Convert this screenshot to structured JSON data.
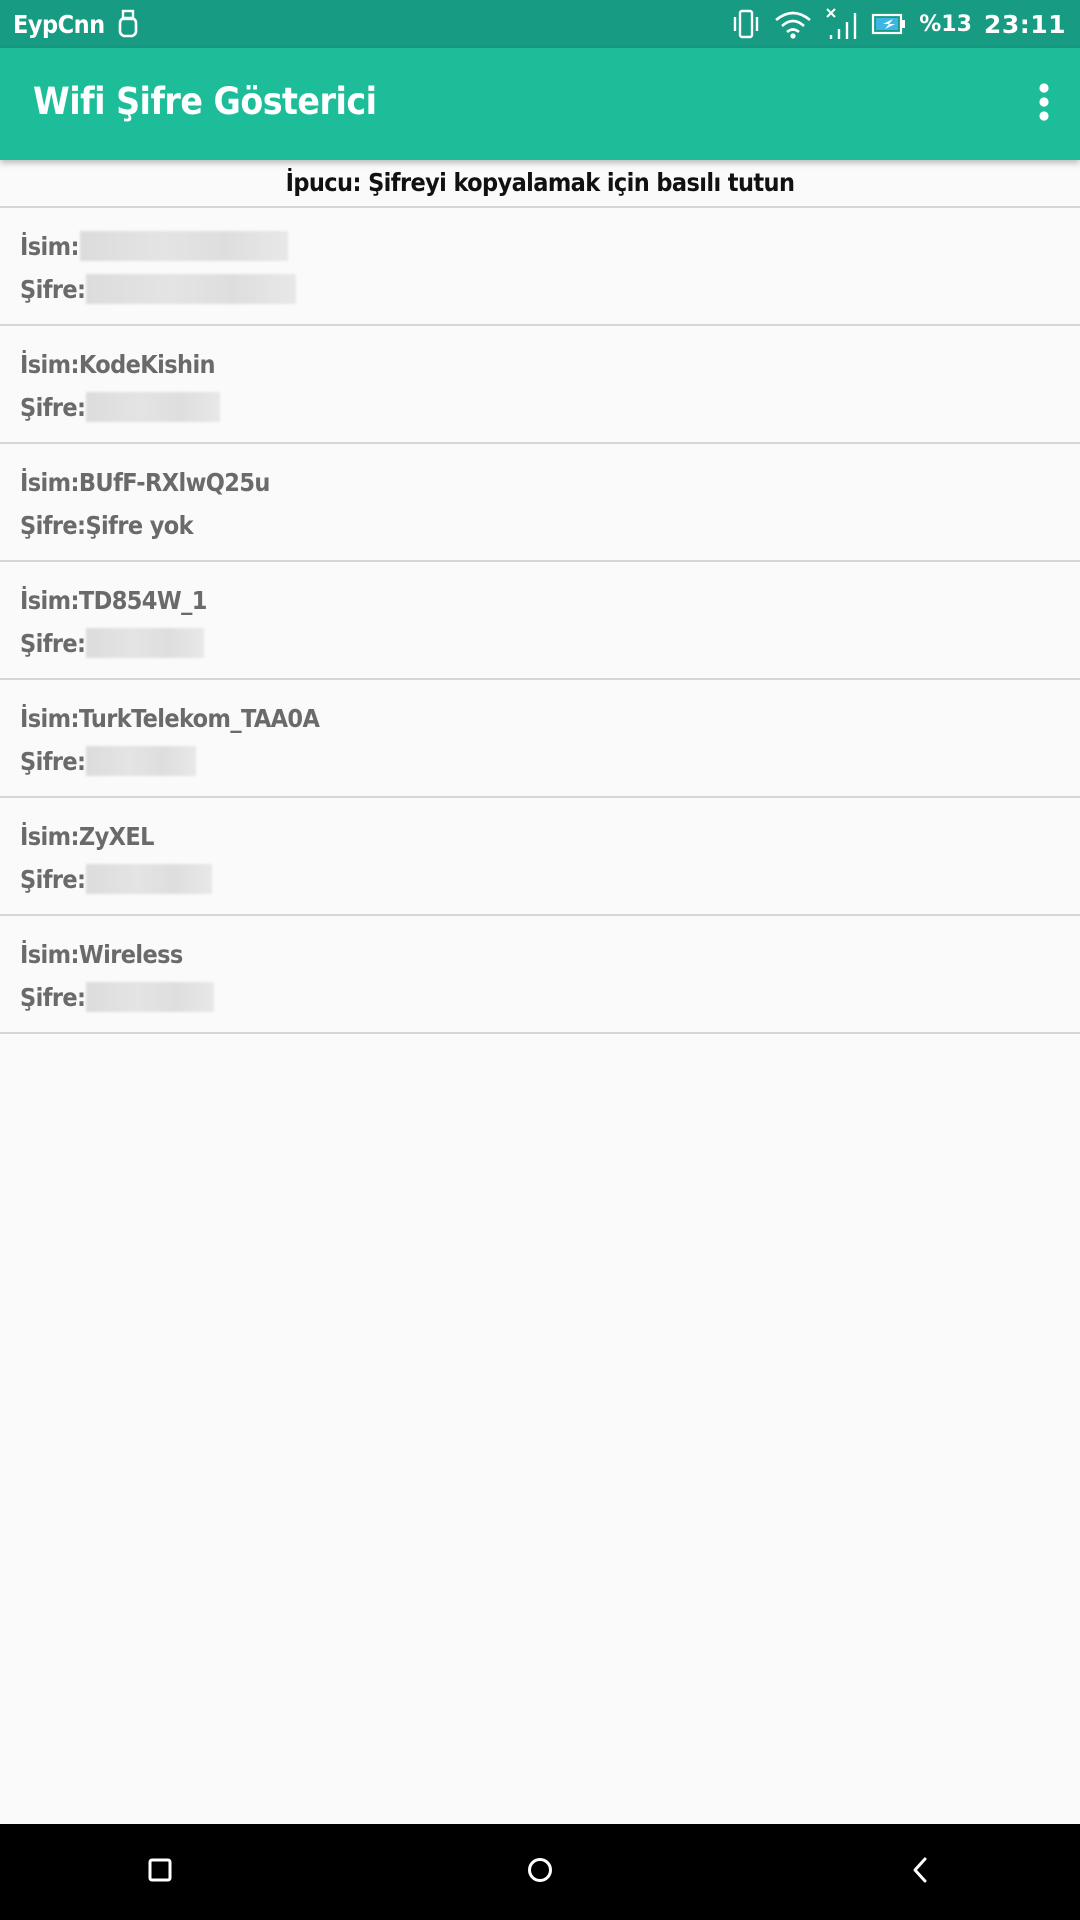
{
  "status_bar": {
    "carrier": "EypCnn",
    "battery_text": "%13",
    "time": "23:11",
    "icons": [
      "usb-icon",
      "vibrate-icon",
      "wifi-icon",
      "no-signal-icon",
      "battery-charging-icon"
    ]
  },
  "app_bar": {
    "title": "Wifi Şifre Gösterici",
    "menu_icon": "more-vert-icon"
  },
  "hint": "İpucu: Şifreyi kopyalamak için basılı tutun",
  "networks": [
    {
      "name_label": "İsim:",
      "name": "",
      "name_redacted": true,
      "password_label": "Şifre:",
      "password": "",
      "password_redacted": true
    },
    {
      "name_label": "İsim:",
      "name": "KodeKishin",
      "name_redacted": false,
      "password_label": "Şifre:",
      "password": "",
      "password_redacted": true
    },
    {
      "name_label": "İsim:",
      "name": "BUfF-RXlwQ25u",
      "name_redacted": false,
      "password_label": "Şifre:",
      "password": "Şifre yok",
      "password_redacted": false
    },
    {
      "name_label": "İsim:",
      "name": "TD854W_1",
      "name_redacted": false,
      "password_label": "Şifre:",
      "password": "",
      "password_redacted": true
    },
    {
      "name_label": "İsim:",
      "name": "TurkTelekom_TAA0A",
      "name_redacted": false,
      "password_label": "Şifre:",
      "password": "",
      "password_redacted": true
    },
    {
      "name_label": "İsim:",
      "name": "ZyXEL",
      "name_redacted": false,
      "password_label": "Şifre:",
      "password": "",
      "password_redacted": true
    },
    {
      "name_label": "İsim:",
      "name": "Wireless",
      "name_redacted": false,
      "password_label": "Şifre:",
      "password": "",
      "password_redacted": true
    }
  ],
  "nav_bar": {
    "buttons": [
      "recents-square-icon",
      "home-circle-icon",
      "back-chevron-icon"
    ]
  },
  "colors": {
    "status_bar": "#179b83",
    "app_bar": "#1dbd9a",
    "background": "#fafafa",
    "item_text": "#6a6a6a",
    "divider": "#d6d6d6"
  }
}
